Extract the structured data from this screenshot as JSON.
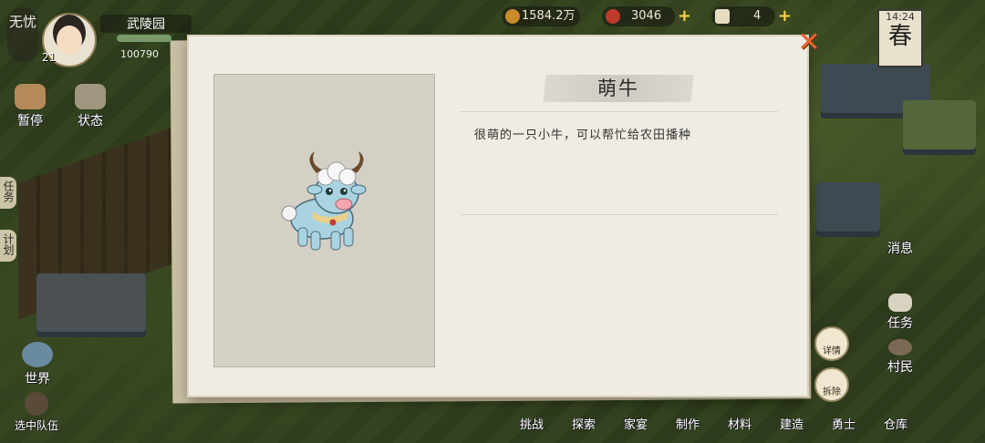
{
  "player": {
    "status_tag": "无忧",
    "location": "武陵园",
    "level": "21",
    "stat_a": "100790"
  },
  "resources": {
    "copper": "1584.2万",
    "gems": "3046",
    "scrolls": "4"
  },
  "clock": {
    "time": "14:24",
    "season": "春"
  },
  "left_buttons": {
    "pause": "暂停",
    "status": "状态",
    "tasks_tab": "任务",
    "plan_tab": "计划",
    "world": "世界",
    "select_team": "选中队伍"
  },
  "right_buttons": {
    "messages": "消息",
    "quests": "任务",
    "villagers": "村民"
  },
  "bottom_nav": [
    "挑战",
    "探索",
    "家宴",
    "制作",
    "材料",
    "建造",
    "勇士",
    "仓库"
  ],
  "modal": {
    "title": "萌牛",
    "description": "很萌的一只小牛，可以帮忙给农田播种",
    "details_btn": "详情",
    "dismantle_btn": "拆除",
    "close_symbol": "✕"
  },
  "colors": {
    "accent": "#e8632e",
    "paper": "#efece3",
    "coin": "#ffd24a"
  }
}
